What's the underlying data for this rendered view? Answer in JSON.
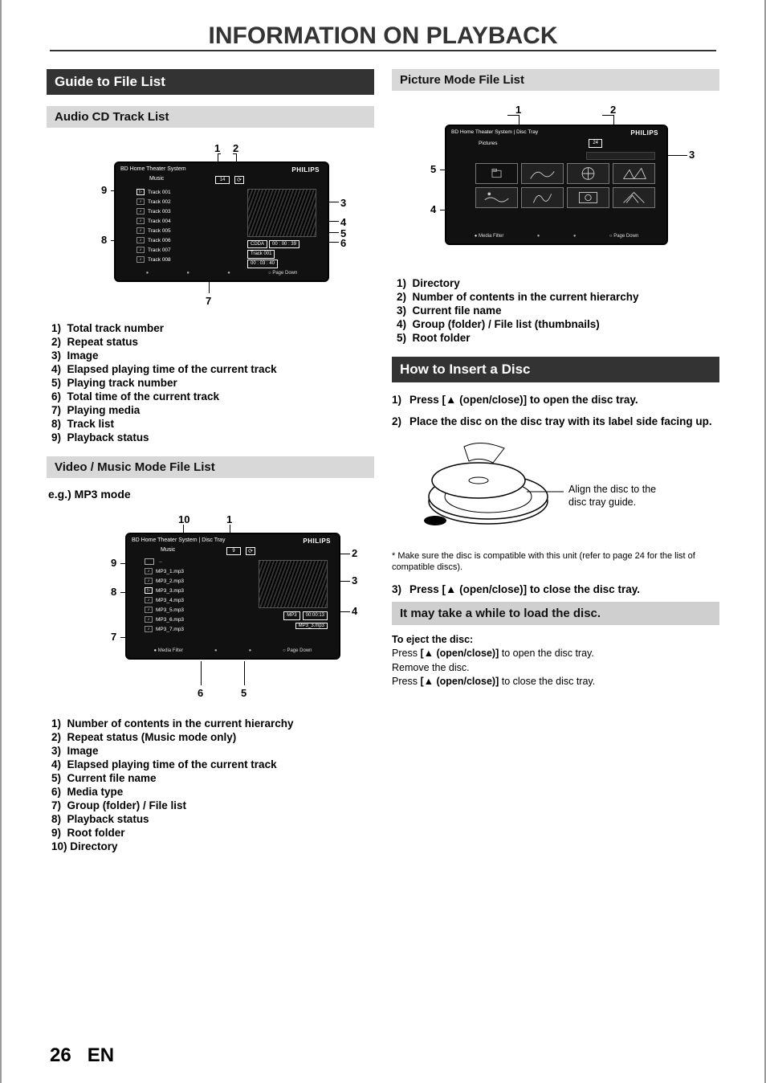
{
  "page": {
    "title": "INFORMATION ON PLAYBACK",
    "number": "26",
    "lang": "EN"
  },
  "left": {
    "bannerGuide": "Guide to File List",
    "bannerAudio": "Audio CD Track List",
    "audioDiagram": {
      "systemTitle": "BD Home Theater System",
      "brand": "PHILIPS",
      "subtitle": "Music",
      "totalTracks": "14",
      "repeat": "⟳",
      "tracks": [
        "Track  001",
        "Track  002",
        "Track  003",
        "Track  004",
        "Track  005",
        "Track  006",
        "Track  007",
        "Track  008"
      ],
      "cdda": "CDDA",
      "elapsed": "00 : 00 : 39",
      "playingTrackLbl": "Track 001",
      "total": "00 : 03 : 40",
      "pageDown": "Page Down",
      "callouts": {
        "1": "1",
        "2": "2",
        "3": "3",
        "4": "4",
        "5": "5",
        "6": "6",
        "7": "7",
        "8": "8",
        "9": "9"
      }
    },
    "audioLegend": [
      "Total track number",
      "Repeat status",
      "Image",
      "Elapsed playing time of the current track",
      "Playing track number",
      "Total time of the current track",
      "Playing media",
      "Track list",
      "Playback status"
    ],
    "bannerVideo": "Video / Music Mode File List",
    "egLabel": "e.g.) MP3 mode",
    "mp3Diagram": {
      "systemTitle": "BD Home Theater System | Disc Tray",
      "brand": "PHILIPS",
      "subtitle": "Music",
      "count": "9",
      "repeat": "⟳",
      "rootDots": "..",
      "files": [
        "MP3_1.mp3",
        "MP3_2.mp3",
        "MP3_3.mp3",
        "MP3_4.mp3",
        "MP3_5.mp3",
        "MP3_6.mp3",
        "MP3_7.mp3"
      ],
      "mediaType": "MP3",
      "elapsed": "00:00:13",
      "currentFile": "MP3_3.mp3",
      "mediaFilter": "Media Filter",
      "pageDown": "Page Down",
      "callouts": {
        "1": "1",
        "2": "2",
        "3": "3",
        "4": "4",
        "5": "5",
        "6": "6",
        "7": "7",
        "8": "8",
        "9": "9",
        "10": "10"
      }
    },
    "mp3Legend": [
      "Number of contents in the current hierarchy",
      "Repeat status (Music mode only)",
      "Image",
      "Elapsed playing time of the current track",
      "Current file name",
      "Media type",
      "Group (folder) / File list",
      "Playback status",
      "Root folder",
      "Directory"
    ]
  },
  "right": {
    "bannerPicture": "Picture Mode File List",
    "picDiagram": {
      "systemTitle": "BD Home Theater System | Disc Tray",
      "brand": "PHILIPS",
      "subtitle": "Pictures",
      "count": "24",
      "mediaFilter": "Media Filter",
      "pageDown": "Page Down",
      "callouts": {
        "1": "1",
        "2": "2",
        "3": "3",
        "4": "4",
        "5": "5"
      }
    },
    "picLegend": [
      "Directory",
      "Number of contents in the current  hierarchy",
      "Current file name",
      "Group (folder) / File list (thumbnails)",
      "Root folder"
    ],
    "bannerInsert": "How to Insert a Disc",
    "insertSteps": {
      "step1pre": "Press [",
      "step1post": " (open/close)] to open the disc tray.",
      "step2": "Place the disc on the disc tray with its label side facing up.",
      "step3pre": "Press [",
      "step3post": " (open/close)] to close the disc tray."
    },
    "discNote": "Align the disc to the disc tray guide.",
    "compatNote": "*  Make sure the disc is compatible with this unit (refer to page 24 for the list of compatible discs).",
    "loadNote": "It may take a while to load the disc.",
    "ejectTitle": "To eject the disc:",
    "eject1a": "Press ",
    "eject1b": " (open/close)]",
    "eject1c": " to open the disc tray.",
    "eject2": "Remove the disc.",
    "eject3a": "Press ",
    "eject3b": " (open/close)]",
    "eject3c": " to close the disc tray.",
    "openBracket": "[",
    "ejectIcon": "▲"
  }
}
